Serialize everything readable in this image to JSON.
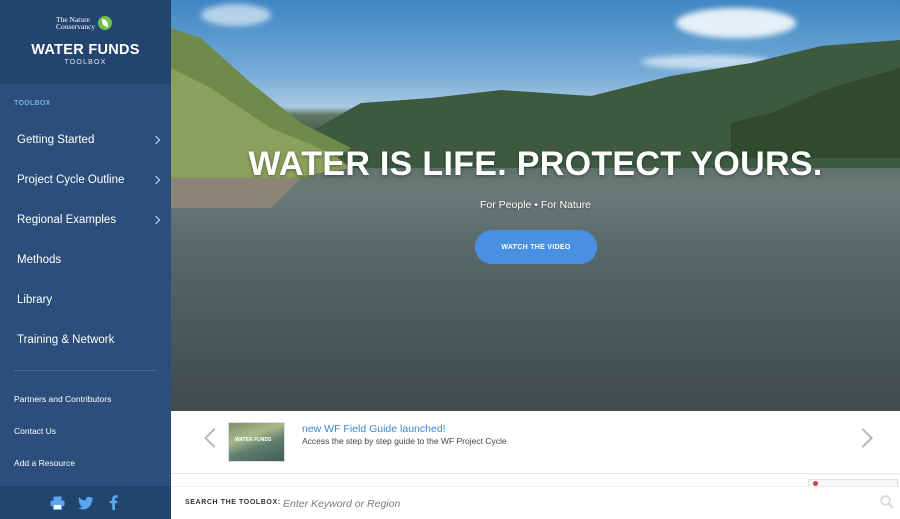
{
  "brand": {
    "org_line1": "The Nature",
    "org_line2": "Conservancy",
    "title": "WATER FUNDS",
    "subtitle": "TOOLBOX"
  },
  "sidebar": {
    "section_label": "TOOLBOX",
    "items": [
      {
        "label": "Getting Started",
        "has_submenu": true
      },
      {
        "label": "Project Cycle Outline",
        "has_submenu": true
      },
      {
        "label": "Regional Examples",
        "has_submenu": true
      },
      {
        "label": "Methods",
        "has_submenu": false
      },
      {
        "label": "Library",
        "has_submenu": false
      },
      {
        "label": "Training & Network",
        "has_submenu": false
      }
    ],
    "links": [
      {
        "label": "Partners and Contributors"
      },
      {
        "label": "Contact Us"
      },
      {
        "label": "Add a Resource"
      }
    ],
    "social": [
      {
        "icon": "print-icon"
      },
      {
        "icon": "twitter-icon"
      },
      {
        "icon": "facebook-icon"
      }
    ]
  },
  "hero": {
    "title": "WATER IS LIFE. PROTECT YOURS.",
    "subtitle": "For People • For Nature",
    "button_label": "WATCH THE VIDEO"
  },
  "news": {
    "thumb_text": "WATER FUNDS",
    "title": "new WF Field Guide launched!",
    "description": "Access the step by step guide to the WF Project Cycle"
  },
  "search": {
    "label": "SEARCH THE TOOLBOX:",
    "placeholder": "Enter Keyword or Region",
    "value": ""
  },
  "colors": {
    "sidebar": "#2b4e7b",
    "brand_bg": "#22446e",
    "accent": "#4a90e2",
    "link": "#3b86d6"
  }
}
